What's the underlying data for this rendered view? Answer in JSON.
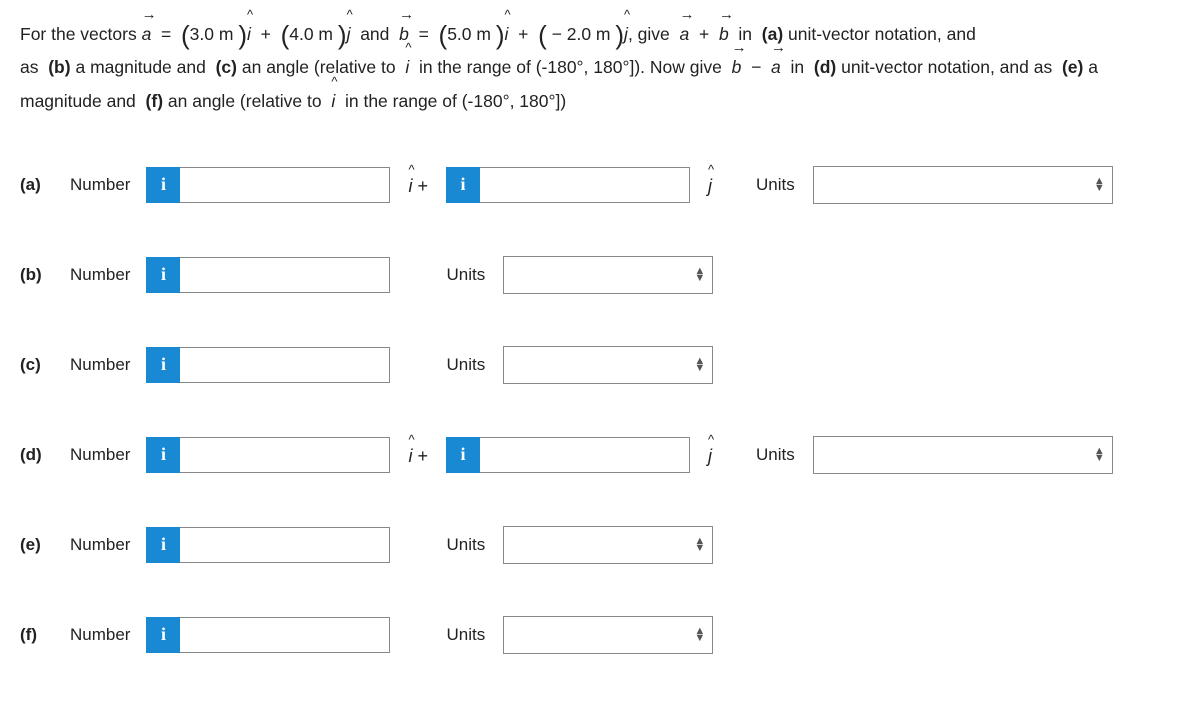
{
  "problem": {
    "intro": "For the vectors",
    "vec_a_name": "a",
    "vec_b_name": "b",
    "a_i_coef": "3.0 m",
    "a_j_coef": "4.0 m",
    "b_i_coef": "5.0 m",
    "b_j_coef": "− 2.0 m",
    "and_text": "and",
    "give_text": ", give",
    "sum_expr_a": "a",
    "sum_expr_plus": "+",
    "sum_expr_b": "b",
    "tail_a1": "in",
    "part_a_lbl": "(a)",
    "uvn_text": "unit-vector notation, and",
    "line2_a": "as",
    "part_b_lbl": "(b)",
    "mag_text": "a magnitude and",
    "part_c_lbl": "(c)",
    "angle_text1": "an angle (relative to",
    "ihat": "i",
    "range1": "in the range of (-180°, 180°]). Now give",
    "diff_b": "b",
    "diff_minus": "−",
    "diff_a": "a",
    "in_text": "in",
    "part_d_lbl": "(d)",
    "uvn2": "unit-vector notation, and as",
    "part_e_lbl": "(e)",
    "mag_text2": "a",
    "line3_mag": "magnitude and",
    "part_f_lbl": "(f)",
    "angle_text2": "an angle (relative to",
    "range2": "in the range of (-180°, 180°])"
  },
  "info_char": "i",
  "rows": {
    "a": {
      "part": "(a)",
      "num": "Number",
      "ihat_plus": "î +",
      "jhat": "ĵ",
      "units": "Units"
    },
    "b": {
      "part": "(b)",
      "num": "Number",
      "units": "Units"
    },
    "c": {
      "part": "(c)",
      "num": "Number",
      "units": "Units"
    },
    "d": {
      "part": "(d)",
      "num": "Number",
      "ihat_plus": "î +",
      "jhat": "ĵ",
      "units": "Units"
    },
    "e": {
      "part": "(e)",
      "num": "Number",
      "units": "Units"
    },
    "f": {
      "part": "(f)",
      "num": "Number",
      "units": "Units"
    }
  }
}
